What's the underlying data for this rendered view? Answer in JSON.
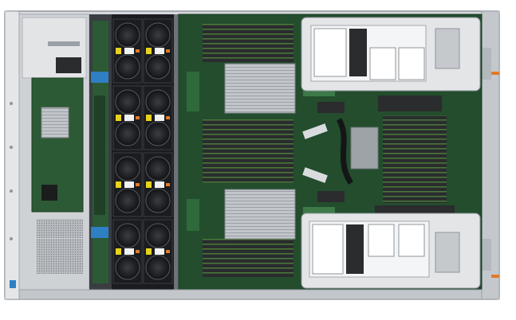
{
  "image": {
    "alt": "",
    "colors": {
      "chassis": "#c9ccd0",
      "chassis_dark": "#9ea3a8",
      "board": "#1f4a2b",
      "board_light": "#2f6b3c",
      "fan": "#1a1c1f",
      "fan_tab": "#e8d21c",
      "accent_blue": "#2f7fc4",
      "accent_orange": "#e07a2a",
      "dimm": "#2a2c2e",
      "heatsink": "#b8bcc1"
    }
  }
}
